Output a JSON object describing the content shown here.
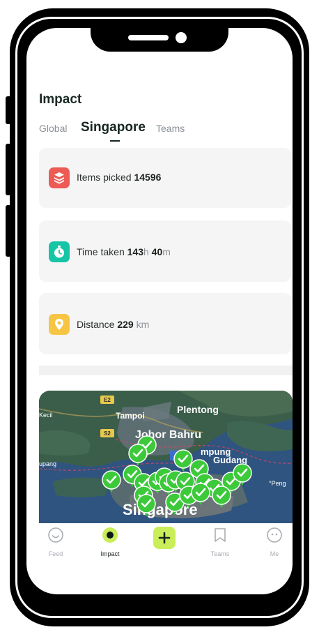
{
  "page": {
    "title": "Impact"
  },
  "tabs": [
    {
      "label": "Global",
      "active": false
    },
    {
      "label": "Singapore",
      "active": true
    },
    {
      "label": "Teams",
      "active": false
    }
  ],
  "stats": {
    "items": {
      "label": "Items picked",
      "value": "14596",
      "icon": "layers-icon",
      "color": "#ec5b54"
    },
    "time": {
      "label": "Time taken",
      "hours": "143",
      "hours_unit": "h",
      "minutes": "40",
      "minutes_unit": "m",
      "icon": "stopwatch-icon",
      "color": "#16c4a6"
    },
    "distance": {
      "label": "Distance",
      "value": "229",
      "unit": "km",
      "icon": "location-pin-icon",
      "color": "#f7c544"
    }
  },
  "map": {
    "labels": {
      "kecil": "Kecil",
      "tampoi": "Tampoi",
      "plentong": "Plentong",
      "johor_bahru": "Johor Bahru",
      "kampung": "mpung",
      "gudang": "Gudang",
      "pupang": "upang",
      "peng": "°Peng",
      "singapore": "Singapore",
      "road_e2": "E2",
      "road_s2": "S2"
    },
    "marker_color": "#3cc93a",
    "marker_count": 22
  },
  "nav": [
    {
      "label": "Feed",
      "icon": "smiley-icon",
      "active": false
    },
    {
      "label": "Impact",
      "icon": "impact-dot-icon",
      "active": true
    },
    {
      "label": "",
      "icon": "plus-icon",
      "active": false
    },
    {
      "label": "Teams",
      "icon": "bookmark-icon",
      "active": false
    },
    {
      "label": "Me",
      "icon": "face-icon",
      "active": false
    }
  ]
}
